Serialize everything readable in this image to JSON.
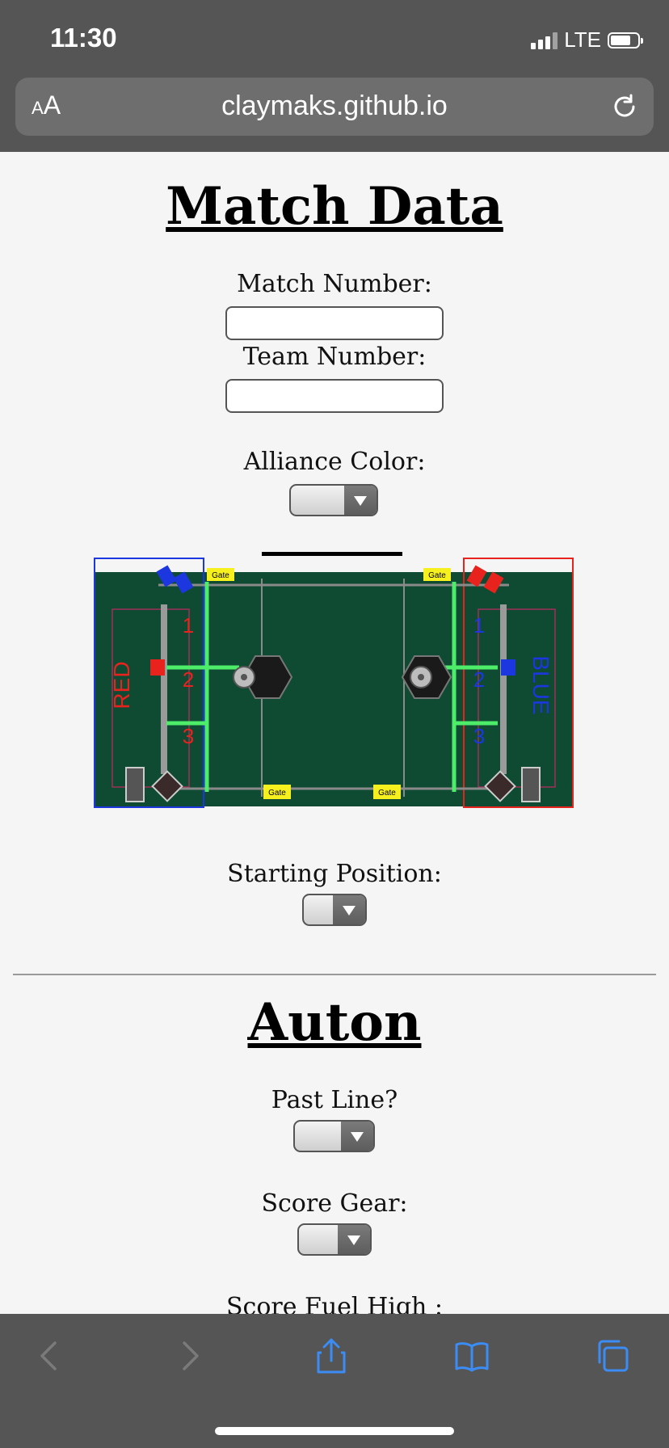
{
  "status_bar": {
    "time": "11:30",
    "network": "LTE"
  },
  "browser": {
    "aa_small": "A",
    "aa_large": "A",
    "url": "claymaks.github.io"
  },
  "match_data": {
    "title": "Match Data",
    "match_number_label": "Match Number:",
    "match_number_value": "",
    "team_number_label": "Team Number:",
    "team_number_value": "",
    "alliance_color_label": "Alliance Color:",
    "alliance_color_value": "",
    "starting_position_label": "Starting Position:",
    "starting_position_value": ""
  },
  "field_map": {
    "red_label": "RED",
    "blue_label": "BLUE",
    "gate_label": "Gate",
    "positions": [
      "1",
      "2",
      "3"
    ],
    "colors": {
      "field": "#0f4a33",
      "red": "#e8231e",
      "blue": "#1c37e0",
      "line": "#4ded6a",
      "gate": "#f5f01e"
    }
  },
  "auton": {
    "title": "Auton",
    "past_line_label": "Past Line?",
    "score_gear_label": "Score Gear:",
    "score_fuel_high_label": "Score Fuel High :"
  },
  "toolbar": {
    "icons": [
      "back-icon",
      "forward-icon",
      "share-icon",
      "bookmarks-icon",
      "tabs-icon"
    ],
    "accent": "#3b8cf5"
  }
}
